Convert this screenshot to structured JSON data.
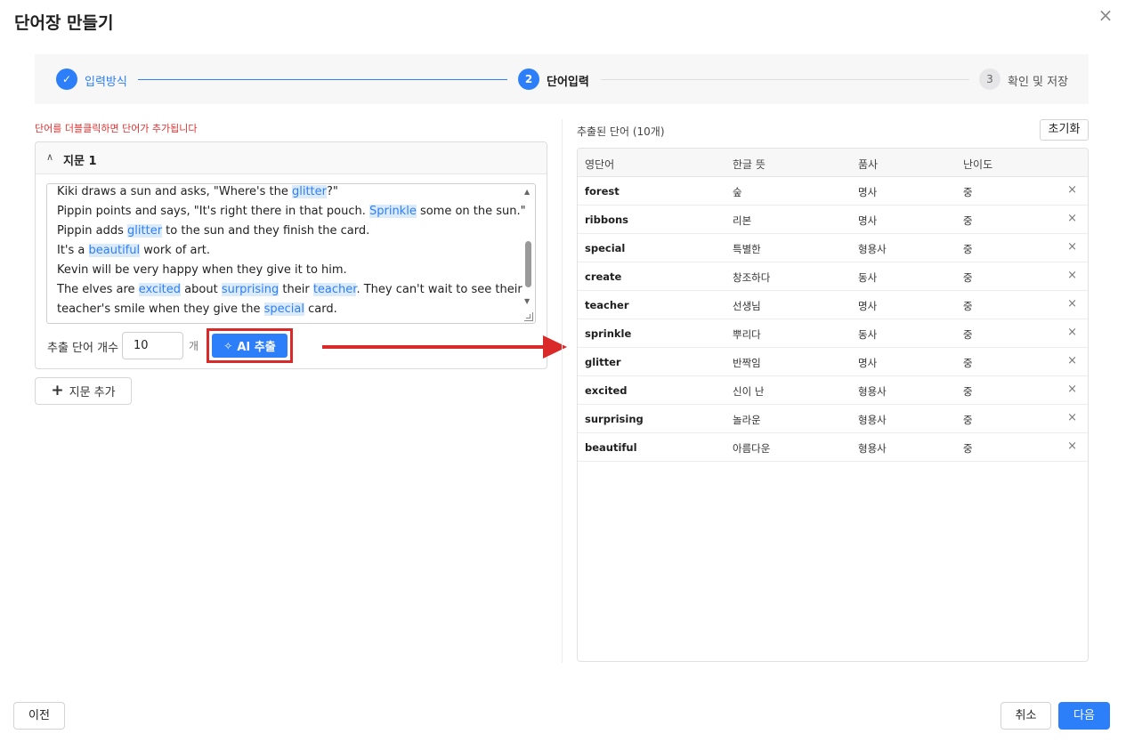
{
  "dialog": {
    "title": "단어장 만들기",
    "close": "×"
  },
  "stepper": {
    "steps": [
      {
        "number": "✓",
        "label": "입력방식",
        "state": "done"
      },
      {
        "number": "2",
        "label": "단어입력",
        "state": "current"
      },
      {
        "number": "3",
        "label": "확인 및 저장",
        "state": "upcoming"
      }
    ]
  },
  "left": {
    "hint": "단어를 더블클릭하면 단어가 추가됩니다",
    "passage": {
      "title": "지문 1",
      "lines": [
        [
          {
            "t": "Kiki draws a sun and asks, \"Where's the "
          },
          {
            "t": "glitter",
            "hl": true
          },
          {
            "t": "?\""
          }
        ],
        [
          {
            "t": "Pippin points and says, \"It's right there in that pouch. "
          },
          {
            "t": "Sprinkle",
            "hl": true
          },
          {
            "t": " some on the sun.\""
          }
        ],
        [
          {
            "t": "Pippin adds "
          },
          {
            "t": "glitter",
            "hl": true
          },
          {
            "t": " to the sun and they finish the card."
          }
        ],
        [
          {
            "t": "It's a "
          },
          {
            "t": "beautiful",
            "hl": true
          },
          {
            "t": " work of art."
          }
        ],
        [
          {
            "t": "Kevin will be very happy when they give it to him."
          }
        ],
        [
          {
            "t": "The elves are "
          },
          {
            "t": "excited",
            "hl": true
          },
          {
            "t": " about "
          },
          {
            "t": "surprising",
            "hl": true
          },
          {
            "t": " their "
          },
          {
            "t": "teacher",
            "hl": true
          },
          {
            "t": ". They can't wait to see their"
          }
        ],
        [
          {
            "t": "teacher's smile when they give the "
          },
          {
            "t": "special",
            "hl": true
          },
          {
            "t": " card."
          }
        ]
      ],
      "count_label": "추출 단어 개수",
      "count_value": "10",
      "count_unit": "개",
      "ai_button": "AI 추출"
    },
    "add_passage": "지문 추가"
  },
  "right": {
    "title": "추출된 단어 (10개)",
    "reset": "초기화",
    "columns": [
      "영단어",
      "한글 뜻",
      "품사",
      "난이도"
    ],
    "rows": [
      {
        "en": "forest",
        "ko": "숲",
        "pos": "명사",
        "level": "중"
      },
      {
        "en": "ribbons",
        "ko": "리본",
        "pos": "명사",
        "level": "중"
      },
      {
        "en": "special",
        "ko": "특별한",
        "pos": "형용사",
        "level": "중"
      },
      {
        "en": "create",
        "ko": "창조하다",
        "pos": "동사",
        "level": "중"
      },
      {
        "en": "teacher",
        "ko": "선생님",
        "pos": "명사",
        "level": "중"
      },
      {
        "en": "sprinkle",
        "ko": "뿌리다",
        "pos": "동사",
        "level": "중"
      },
      {
        "en": "glitter",
        "ko": "반짝임",
        "pos": "명사",
        "level": "중"
      },
      {
        "en": "excited",
        "ko": "신이 난",
        "pos": "형용사",
        "level": "중"
      },
      {
        "en": "surprising",
        "ko": "놀라운",
        "pos": "형용사",
        "level": "중"
      },
      {
        "en": "beautiful",
        "ko": "아름다운",
        "pos": "형용사",
        "level": "중"
      }
    ],
    "delete_symbol": "×"
  },
  "footer": {
    "prev": "이전",
    "cancel": "취소",
    "next": "다음"
  },
  "colors": {
    "accent": "#2d7ff9",
    "highlight_bg": "#dcebfb",
    "annotation_red": "#d92929",
    "hint_red": "#e03131"
  }
}
